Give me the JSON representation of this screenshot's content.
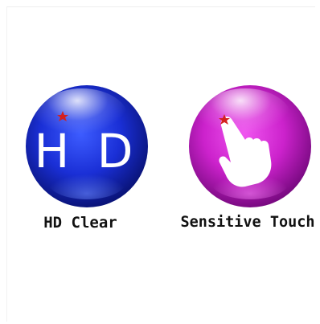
{
  "features": [
    {
      "id": "hd-clear",
      "icon_text": "H D",
      "label": "HD Clear",
      "orb_color": "#1a2fd6",
      "orb_color_dark": "#0a147a"
    },
    {
      "id": "sensitive-touch",
      "icon_name": "touch-hand-icon",
      "label": "Sensitive Touch",
      "orb_color": "#cc22cc",
      "orb_color_dark": "#7a0a82"
    }
  ],
  "accent_star_color": "#d42020"
}
